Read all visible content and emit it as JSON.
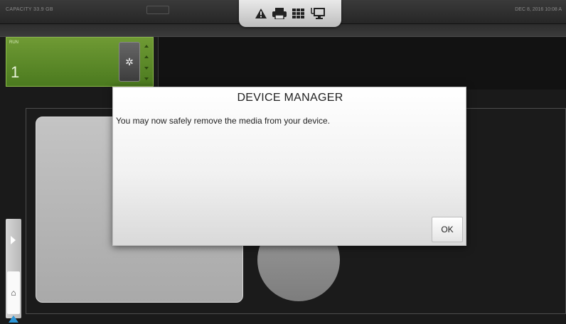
{
  "top_bar": {
    "capacity": "CAPACITY  33.9 GB",
    "center_label": "",
    "datetime": "DEC 8, 2016  10:08 A",
    "status_icons": [
      "warning-icon",
      "printer-icon",
      "grid-icon",
      "network-icon"
    ]
  },
  "run_tile": {
    "label": "RUN",
    "number": "1",
    "settings_icon": "gear-icon",
    "color": "#5e8a2a"
  },
  "dialog": {
    "title": "DEVICE MANAGER",
    "message": "You may now safely remove the media from your device.",
    "ok_label": "OK"
  },
  "accent": {
    "blue": "#2c95d6"
  }
}
